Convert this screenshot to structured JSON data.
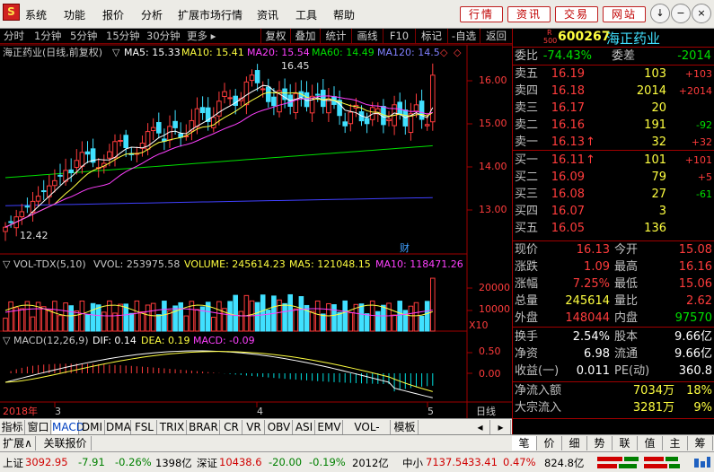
{
  "menubar": {
    "logo": "S",
    "items": [
      "系统",
      "功能",
      "报价",
      "分析",
      "扩展市场行情",
      "资讯",
      "工具",
      "帮助"
    ],
    "right_buttons": [
      "行情",
      "资讯",
      "交易",
      "网站"
    ],
    "window_controls": [
      "↓",
      "−",
      "□",
      "×"
    ]
  },
  "toolbar": {
    "periods": [
      "分时",
      "1分钟",
      "5分钟",
      "15分钟",
      "30分钟",
      "更多 ▸"
    ],
    "actions": [
      "复权",
      "叠加",
      "统计",
      "画线",
      "F10",
      "标记",
      "-自选",
      "返回"
    ]
  },
  "colors": {
    "up": "#ff3c3c",
    "down": "#00e000",
    "ma5": "#ffffff",
    "ma10": "#ffff40",
    "ma20": "#ff40ff",
    "ma60": "#00e000",
    "ma120": "#4040ff",
    "macd_dif": "#ffffff",
    "macd_dea": "#ffff40"
  },
  "main_chart": {
    "title": "海正药业(日线,前复权)",
    "ma": [
      {
        "label": "MA5: 15.33",
        "color": "#ffffff"
      },
      {
        "label": "MA10: 15.41",
        "color": "#ffff40"
      },
      {
        "label": "MA20: 15.54",
        "color": "#ff40ff"
      },
      {
        "label": "MA60: 14.49",
        "color": "#00e000"
      },
      {
        "label": "MA120: 14.5",
        "color": "#4040ff"
      }
    ],
    "high_mark": "16.45",
    "low_mark": "12.42",
    "fin_mark": "财",
    "y_ticks": [
      "16.00",
      "15.00",
      "14.00",
      "13.00"
    ]
  },
  "volume_panel": {
    "header": "▽ VOL-TDX(5,10)",
    "vvol": "VVOL: 253975.58",
    "volume": "VOLUME: 245614.23",
    "ma5": "MA5: 121048.15",
    "ma10": "MA10: 118471.26",
    "y_ticks": [
      "20000",
      "10000"
    ],
    "unit": "X10"
  },
  "macd_panel": {
    "header": "▽ MACD(12,26,9)",
    "dif": "DIF: 0.14",
    "dea": "DEA: 0.19",
    "macd": "MACD: -0.09",
    "y_ticks": [
      "0.50",
      "0.00"
    ]
  },
  "x_axis": {
    "year": "2018年",
    "months": [
      "3",
      "4",
      "5"
    ],
    "period": "日线"
  },
  "bottom_tabs": [
    "指标",
    "窗口",
    "MACD",
    "DMI",
    "DMA",
    "FSL",
    "TRIX",
    "BRAR",
    "CR",
    "VR",
    "OBV",
    "ASI",
    "EMV",
    "VOL-TDX",
    "模板"
  ],
  "bottom_tabs_row2": [
    "扩展∧",
    "关联报价"
  ],
  "right_tabs": [
    "笔",
    "价",
    "细",
    "势",
    "联",
    "值",
    "主",
    "筹"
  ],
  "quote": {
    "code": "600267",
    "name": "海正药业",
    "badge_r": "R",
    "badge_num": "500",
    "weibi_label": "委比",
    "weibi": "-74.43%",
    "weicha_label": "委差",
    "weicha": "-2014",
    "sell": [
      {
        "label": "卖五",
        "price": "16.19",
        "vol": "103",
        "chg": "+103",
        "pc": "up",
        "cc": "up"
      },
      {
        "label": "卖四",
        "price": "16.18",
        "vol": "2014",
        "chg": "+2014",
        "pc": "up",
        "cc": "up"
      },
      {
        "label": "卖三",
        "price": "16.17",
        "vol": "20",
        "chg": "",
        "pc": "up",
        "cc": "up"
      },
      {
        "label": "卖二",
        "price": "16.16",
        "vol": "191",
        "chg": "-92",
        "pc": "up",
        "cc": "dn"
      },
      {
        "label": "卖一",
        "price": "16.13",
        "arrow": "↑",
        "vol": "32",
        "chg": "+32",
        "pc": "up",
        "cc": "up"
      }
    ],
    "buy": [
      {
        "label": "买一",
        "price": "16.11",
        "arrow": "↑",
        "vol": "101",
        "chg": "+101",
        "pc": "up",
        "cc": "up"
      },
      {
        "label": "买二",
        "price": "16.09",
        "vol": "79",
        "chg": "+5",
        "pc": "up",
        "cc": "up"
      },
      {
        "label": "买三",
        "price": "16.08",
        "vol": "27",
        "chg": "-61",
        "pc": "up",
        "cc": "dn"
      },
      {
        "label": "买四",
        "price": "16.07",
        "vol": "3",
        "chg": "",
        "pc": "up",
        "cc": "up"
      },
      {
        "label": "买五",
        "price": "16.05",
        "vol": "136",
        "chg": "",
        "pc": "up",
        "cc": "up"
      }
    ],
    "stats": [
      [
        {
          "l": "现价",
          "v": "16.13",
          "c": "up"
        },
        {
          "l": "今开",
          "v": "15.08",
          "c": "up"
        }
      ],
      [
        {
          "l": "涨跌",
          "v": "1.09",
          "c": "up"
        },
        {
          "l": "最高",
          "v": "16.16",
          "c": "up"
        }
      ],
      [
        {
          "l": "涨幅",
          "v": "7.25%",
          "c": "up"
        },
        {
          "l": "最低",
          "v": "15.06",
          "c": "up"
        }
      ],
      [
        {
          "l": "总量",
          "v": "245614",
          "c": "yel"
        },
        {
          "l": "量比",
          "v": "2.62",
          "c": "up"
        }
      ],
      [
        {
          "l": "外盘",
          "v": "148044",
          "c": "up"
        },
        {
          "l": "内盘",
          "v": "97570",
          "c": "dn"
        }
      ]
    ],
    "stats2": [
      [
        {
          "l": "换手",
          "v": "2.54%",
          "c": "wh"
        },
        {
          "l": "股本",
          "v": "9.66亿",
          "c": "wh"
        }
      ],
      [
        {
          "l": "净资",
          "v": "6.98",
          "c": "wh"
        },
        {
          "l": "流通",
          "v": "9.66亿",
          "c": "wh"
        }
      ],
      [
        {
          "l": "收益(一)",
          "v": "0.011",
          "c": "wh"
        },
        {
          "l": "PE(动)",
          "v": "360.8",
          "c": "wh"
        }
      ]
    ],
    "flow": [
      {
        "l": "净流入额",
        "v": "7034万",
        "p": "18%"
      },
      {
        "l": "大宗流入",
        "v": "3281万",
        "p": "9%"
      }
    ]
  },
  "status_bar": {
    "sh_label": "上证",
    "sh_val": "3092.95",
    "sh_chg": "-7.91",
    "sh_pct": "-0.26%",
    "sh_amt": "1398亿",
    "sz_label": "深证",
    "sz_val": "10438.6",
    "sz_chg": "-20.00",
    "sz_pct": "-0.19%",
    "sz_amt": "2012亿",
    "zx_label": "中小",
    "zx_val": "7137.54",
    "zx_chg": "33.41",
    "zx_pct": "0.47%",
    "zx_amt": "824.8亿"
  }
}
